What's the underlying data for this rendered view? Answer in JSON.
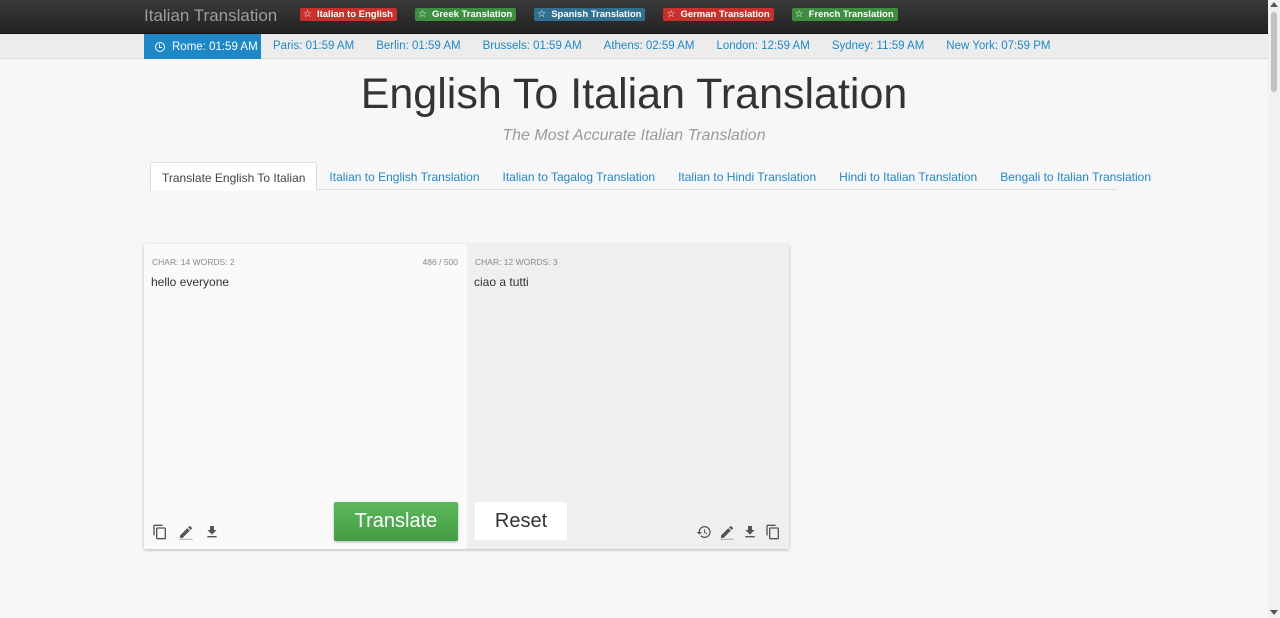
{
  "brand": "Italian Translation",
  "badges": [
    {
      "label": "Italian to English",
      "color": "#c9302c"
    },
    {
      "label": "Greek Translation",
      "color": "#3e8e41"
    },
    {
      "label": "Spanish Translation",
      "color": "#31708f"
    },
    {
      "label": "German Translation",
      "color": "#c9302c"
    },
    {
      "label": "French Translation",
      "color": "#3e8e41"
    }
  ],
  "clocks": {
    "active": "Rome: 01:59 AM",
    "others": [
      "Paris: 01:59 AM",
      "Berlin: 01:59 AM",
      "Brussels: 01:59 AM",
      "Athens: 02:59 AM",
      "London: 12:59 AM",
      "Sydney: 11:59 AM",
      "New York: 07:59 PM"
    ]
  },
  "page": {
    "title": "English To Italian Translation",
    "subtitle": "The Most Accurate Italian Translation"
  },
  "tabs": [
    {
      "label": "Translate English To Italian",
      "active": true
    },
    {
      "label": "Italian to English Translation"
    },
    {
      "label": "Italian to Tagalog Translation"
    },
    {
      "label": "Italian to Hindi Translation"
    },
    {
      "label": "Hindi to Italian Translation"
    },
    {
      "label": "Bengali to Italian Translation"
    }
  ],
  "source": {
    "stats": "CHAR: 14  WORDS: 2",
    "counter": "486 / 500",
    "text": "hello everyone",
    "translate_label": "Translate"
  },
  "target": {
    "stats": "CHAR: 12  WORDS: 3",
    "text": "ciao a tutti",
    "reset_label": "Reset"
  },
  "icons": {
    "source": [
      "copy-icon",
      "edit-icon",
      "download-icon"
    ],
    "target": [
      "history-icon",
      "edit-icon",
      "download-icon",
      "copy-icon"
    ]
  },
  "colors": {
    "link": "#1e88c7",
    "active_clock": "#1e88c7",
    "translate_button": "#4cae4c"
  }
}
